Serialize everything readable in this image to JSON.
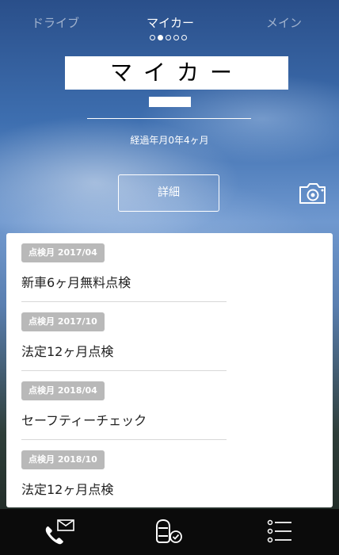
{
  "tabs": [
    "ドライブ",
    "マイカー",
    "メイン"
  ],
  "car": {
    "name": "マイカー",
    "elapsed": "経過年月0年4ヶ月"
  },
  "buttons": {
    "detail": "詳細"
  },
  "inspections": [
    {
      "badge": "点検月 2017/04",
      "title": "新車6ヶ月無料点検"
    },
    {
      "badge": "点検月 2017/10",
      "title": "法定12ヶ月点検"
    },
    {
      "badge": "点検月 2018/04",
      "title": "セーフティーチェック"
    },
    {
      "badge": "点検月 2018/10",
      "title": "法定12ヶ月点検"
    }
  ],
  "page_indicator": {
    "count": 5,
    "active": 2
  },
  "icons": {
    "camera": "camera-icon",
    "contact": "phone-mail-icon",
    "car_check": "car-check-icon",
    "menu": "list-menu-icon"
  },
  "colors": {
    "badge": "#b9b9b9",
    "card": "#ffffff",
    "bottom_bar": "#0b0b0b"
  }
}
